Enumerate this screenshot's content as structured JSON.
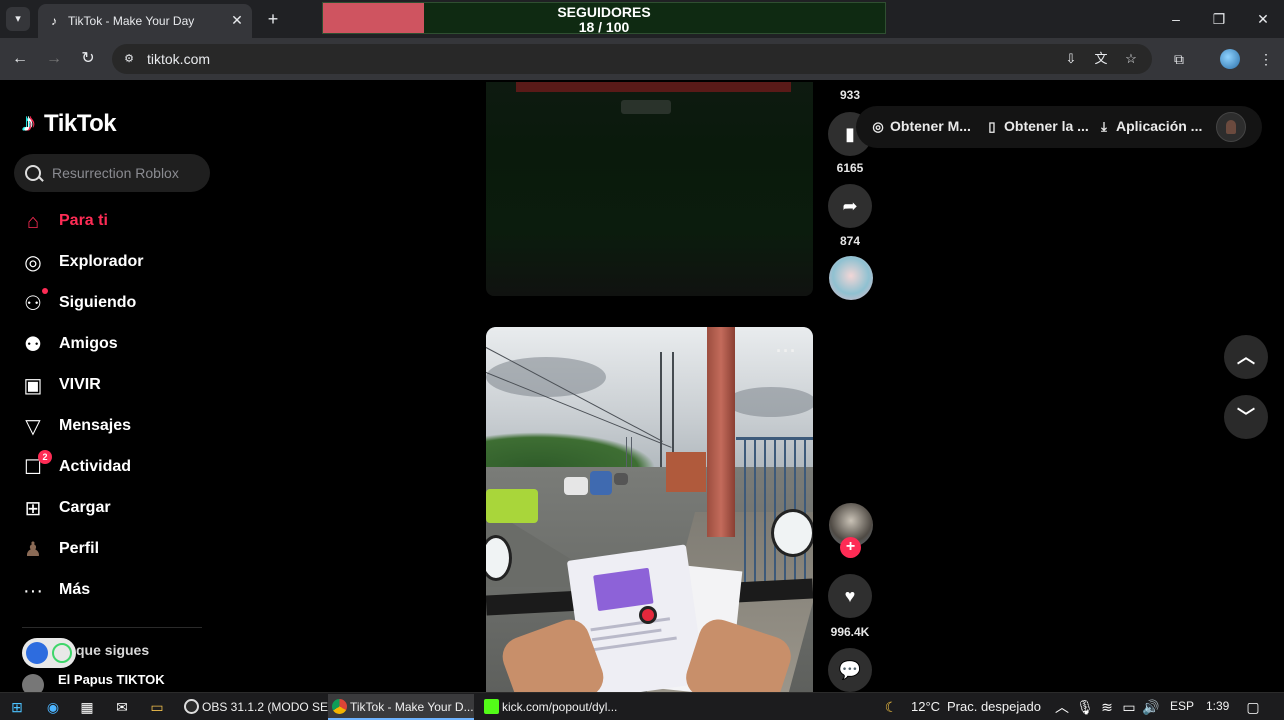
{
  "browser": {
    "tab_title": "TikTok - Make Your Day",
    "tab_close": "✕",
    "new_tab": "+",
    "url": "tiktok.com",
    "window_controls": [
      "–",
      "❐",
      "✕"
    ]
  },
  "overlay": {
    "label": "SEGUIDORES",
    "count_text": "18 / 100",
    "progress_fraction": 0.18,
    "fill_color": "#cf5460",
    "track_color": "#0f2a12"
  },
  "sidebar": {
    "logo": "TikTok",
    "search_placeholder": "Resurrection Roblox",
    "items": [
      {
        "label": "Para ti",
        "icon": "home-icon",
        "active": true
      },
      {
        "label": "Explorador",
        "icon": "compass-icon"
      },
      {
        "label": "Siguiendo",
        "icon": "following-icon"
      },
      {
        "label": "Amigos",
        "icon": "friends-icon"
      },
      {
        "label": "VIVIR",
        "icon": "live-icon"
      },
      {
        "label": "Mensajes",
        "icon": "messages-icon"
      },
      {
        "label": "Actividad",
        "icon": "activity-icon",
        "badge": "2"
      },
      {
        "label": "Cargar",
        "icon": "upload-icon"
      },
      {
        "label": "Perfil",
        "icon": "profile-icon"
      },
      {
        "label": "Más",
        "icon": "more-icon"
      }
    ],
    "following_heading": "que sigues",
    "following_user": "El Papus TIKTOK"
  },
  "feed": {
    "prev_video": {
      "save_count": "933",
      "save_count2": "6165",
      "share_count": "874"
    },
    "current_video": {
      "like_count": "996.4K",
      "more": "···"
    }
  },
  "top_actions": {
    "items": [
      "Obtener M...",
      "Obtener la ...",
      "Aplicación ..."
    ]
  },
  "taskbar": {
    "apps": [
      "OBS 31.1.2 (MODO SE...",
      "TikTok - Make Your D...",
      "kick.com/popout/dyl..."
    ],
    "weather": "12°C",
    "weather_desc": "Prac. despejado",
    "lang": "ESP",
    "time": "1:39"
  },
  "colors": {
    "accent": "#fe2c55",
    "background": "#000000"
  }
}
